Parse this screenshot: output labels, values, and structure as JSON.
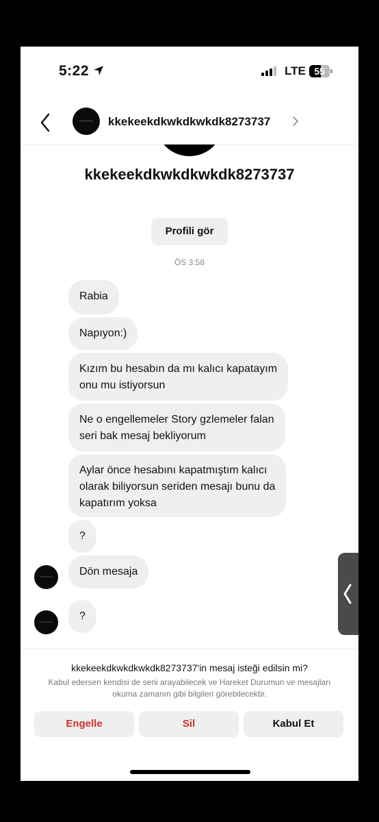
{
  "status_bar": {
    "time": "5:22",
    "network": "LTE",
    "battery": "55",
    "battery_level": 0.55
  },
  "header": {
    "username": "kkekeekdkwkdkwkdk8273737"
  },
  "profile": {
    "name": "kkekeekdkwkdkwkdk8273737",
    "view_profile_label": "Profili gör",
    "timestamp": "ÖS 3:58"
  },
  "messages": [
    {
      "text": "Rabia"
    },
    {
      "text": "Napıyon:)"
    },
    {
      "text": "Kızım bu hesabın da mı kalıcı kapatayım\nonu mu istiyorsun"
    },
    {
      "text": "Ne o engellemeler Story gzlemeler falan\nseri bak mesaj bekliyorum"
    },
    {
      "text": "Aylar önce hesabını kapatmıştım kalıcı\nolarak biliyorsun seriden mesajı bunu da\nkapatırım yoksa"
    },
    {
      "text": "?"
    },
    {
      "text": "Dön mesaja"
    },
    {
      "text": "?"
    }
  ],
  "request": {
    "title": "kkekeekdkwkdkwkdk8273737'in mesaj isteği edilsin mi?",
    "description": "Kabul edersen kendisi de seni arayabilecek ve Hareket Durumun ve mesajları okuma zamanın gibi bilgileri görebilecektir.",
    "block_label": "Engelle",
    "delete_label": "Sil",
    "accept_label": "Kabul Et"
  },
  "colors": {
    "danger": "#d0312d",
    "bubble": "#efefef"
  }
}
